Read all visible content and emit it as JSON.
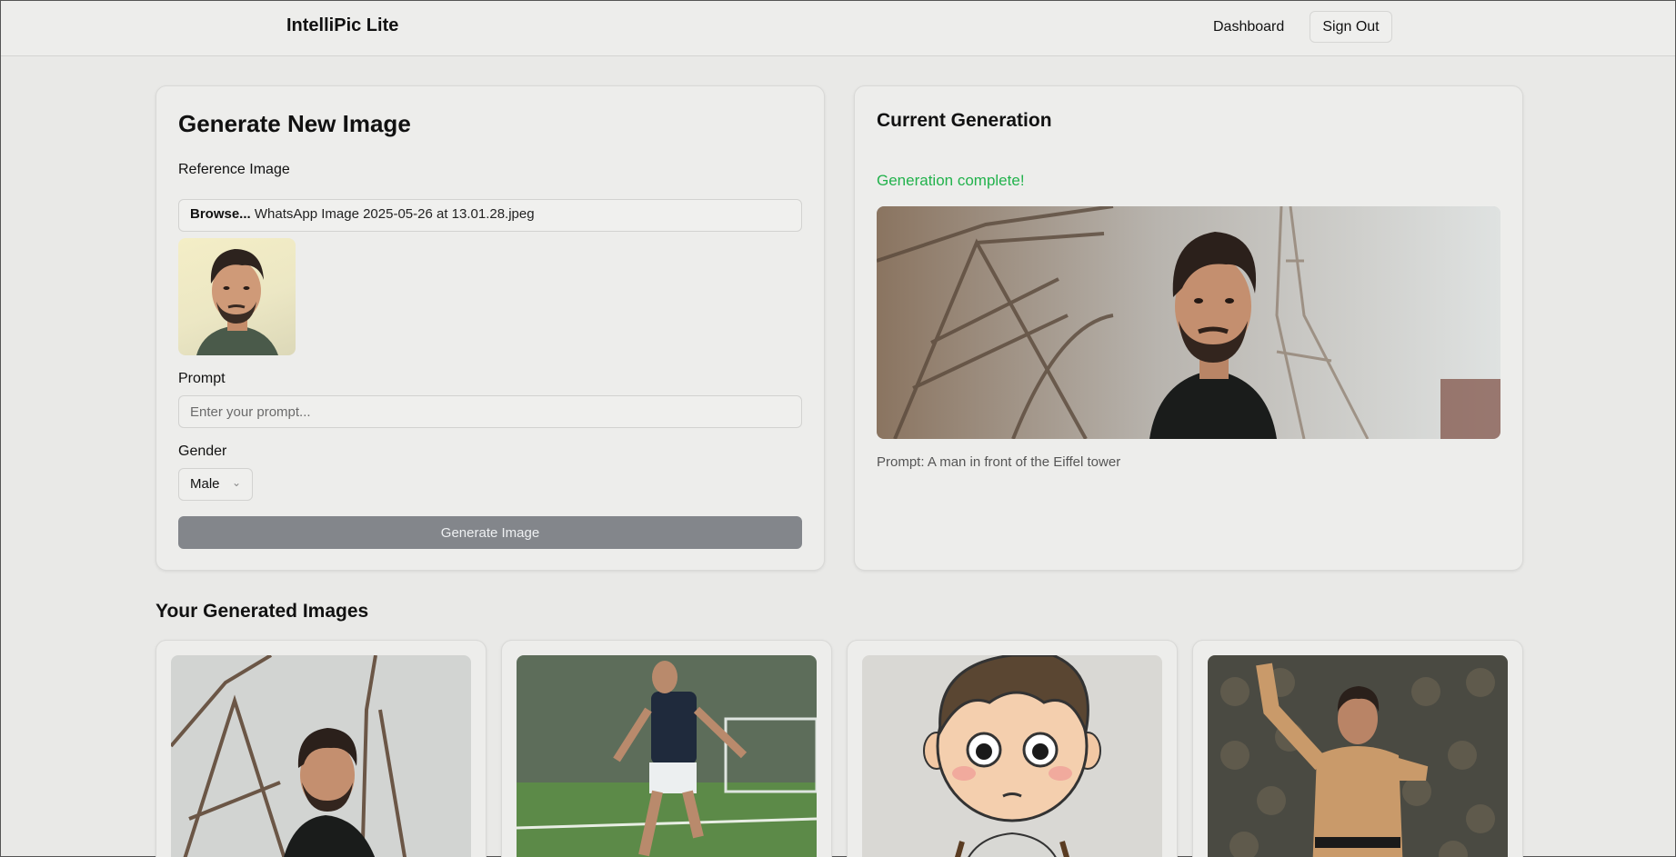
{
  "header": {
    "brand": "IntelliPic Lite",
    "nav_dashboard": "Dashboard",
    "signout_label": "Sign Out"
  },
  "generate": {
    "title": "Generate New Image",
    "reference_label": "Reference Image",
    "browse_label": "Browse...",
    "file_name": "WhatsApp Image 2025-05-26 at 13.01.28.jpeg",
    "prompt_label": "Prompt",
    "prompt_placeholder": "Enter your prompt...",
    "prompt_value": "",
    "gender_label": "Gender",
    "gender_value": "Male",
    "button_label": "Generate Image"
  },
  "current": {
    "title": "Current Generation",
    "status": "Generation complete!",
    "status_color": "#22b24c",
    "prompt_text": "Prompt: A man in front of the Eiffel tower"
  },
  "gallery": {
    "title": "Your Generated Images",
    "items": [
      {
        "subject": "man-in-front-of-eiffel-tower"
      },
      {
        "subject": "man-playing-soccer"
      },
      {
        "subject": "cartoon-boy"
      },
      {
        "subject": "martial-artist-with-monkeys"
      }
    ]
  }
}
